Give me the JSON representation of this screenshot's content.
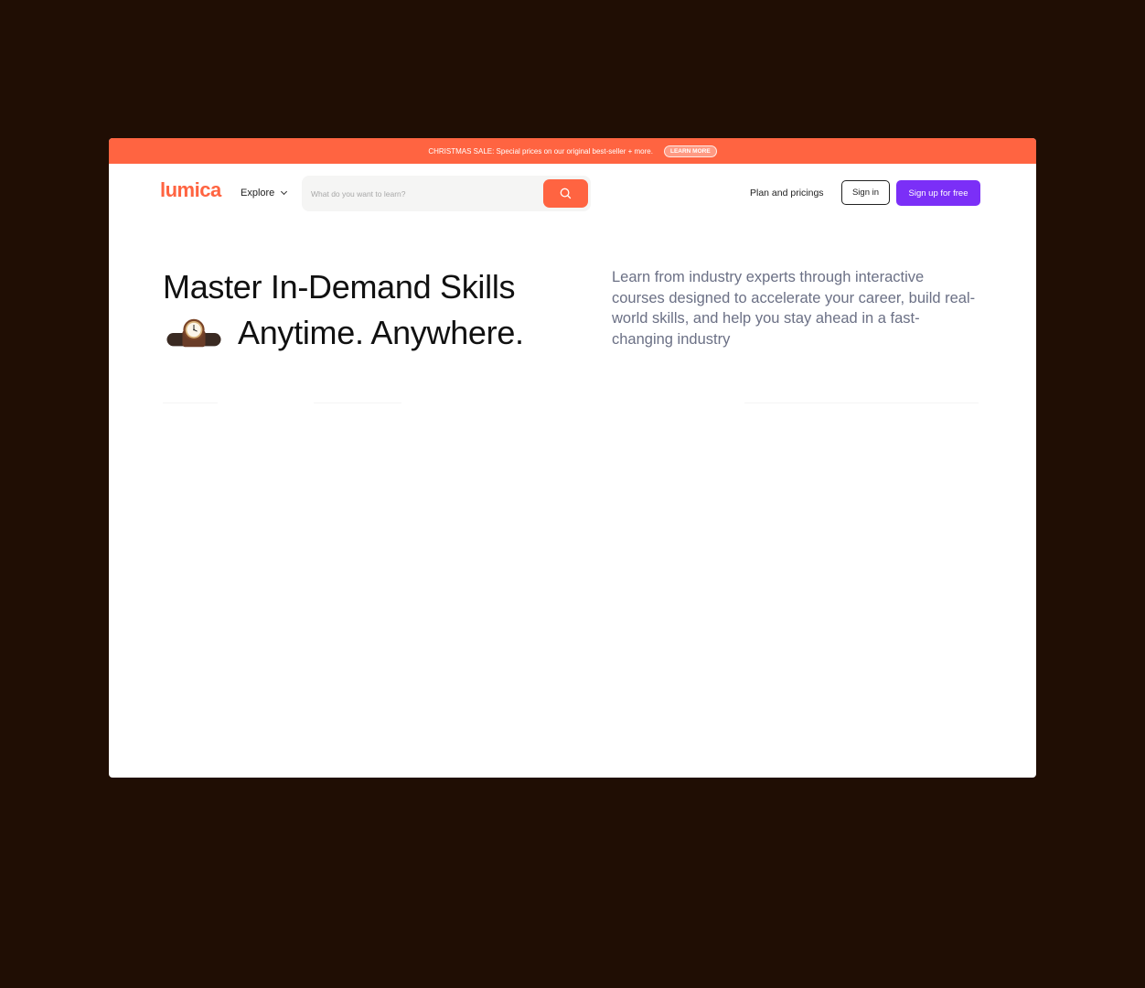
{
  "promo": {
    "text": "CHRISTMAS SALE: Special prices on our original best-seller + more.",
    "button": "LEARN MORE"
  },
  "nav": {
    "logo": "lumica",
    "explore": "Explore",
    "search_placeholder": "What do you want to learn?",
    "plan": "Plan and pricings",
    "signin": "Sign in",
    "signup": "Sign up for free"
  },
  "hero": {
    "title_line1": "Master In-Demand Skills",
    "title_line2": "Anytime. Anywhere.",
    "description": "Learn from industry experts through interactive courses designed to accelerate your career, build real-world skills, and help you stay ahead in a fast-changing industry"
  },
  "colors": {
    "background": "#200e04",
    "accent": "#ff6441",
    "primary": "#7b2ff7"
  }
}
